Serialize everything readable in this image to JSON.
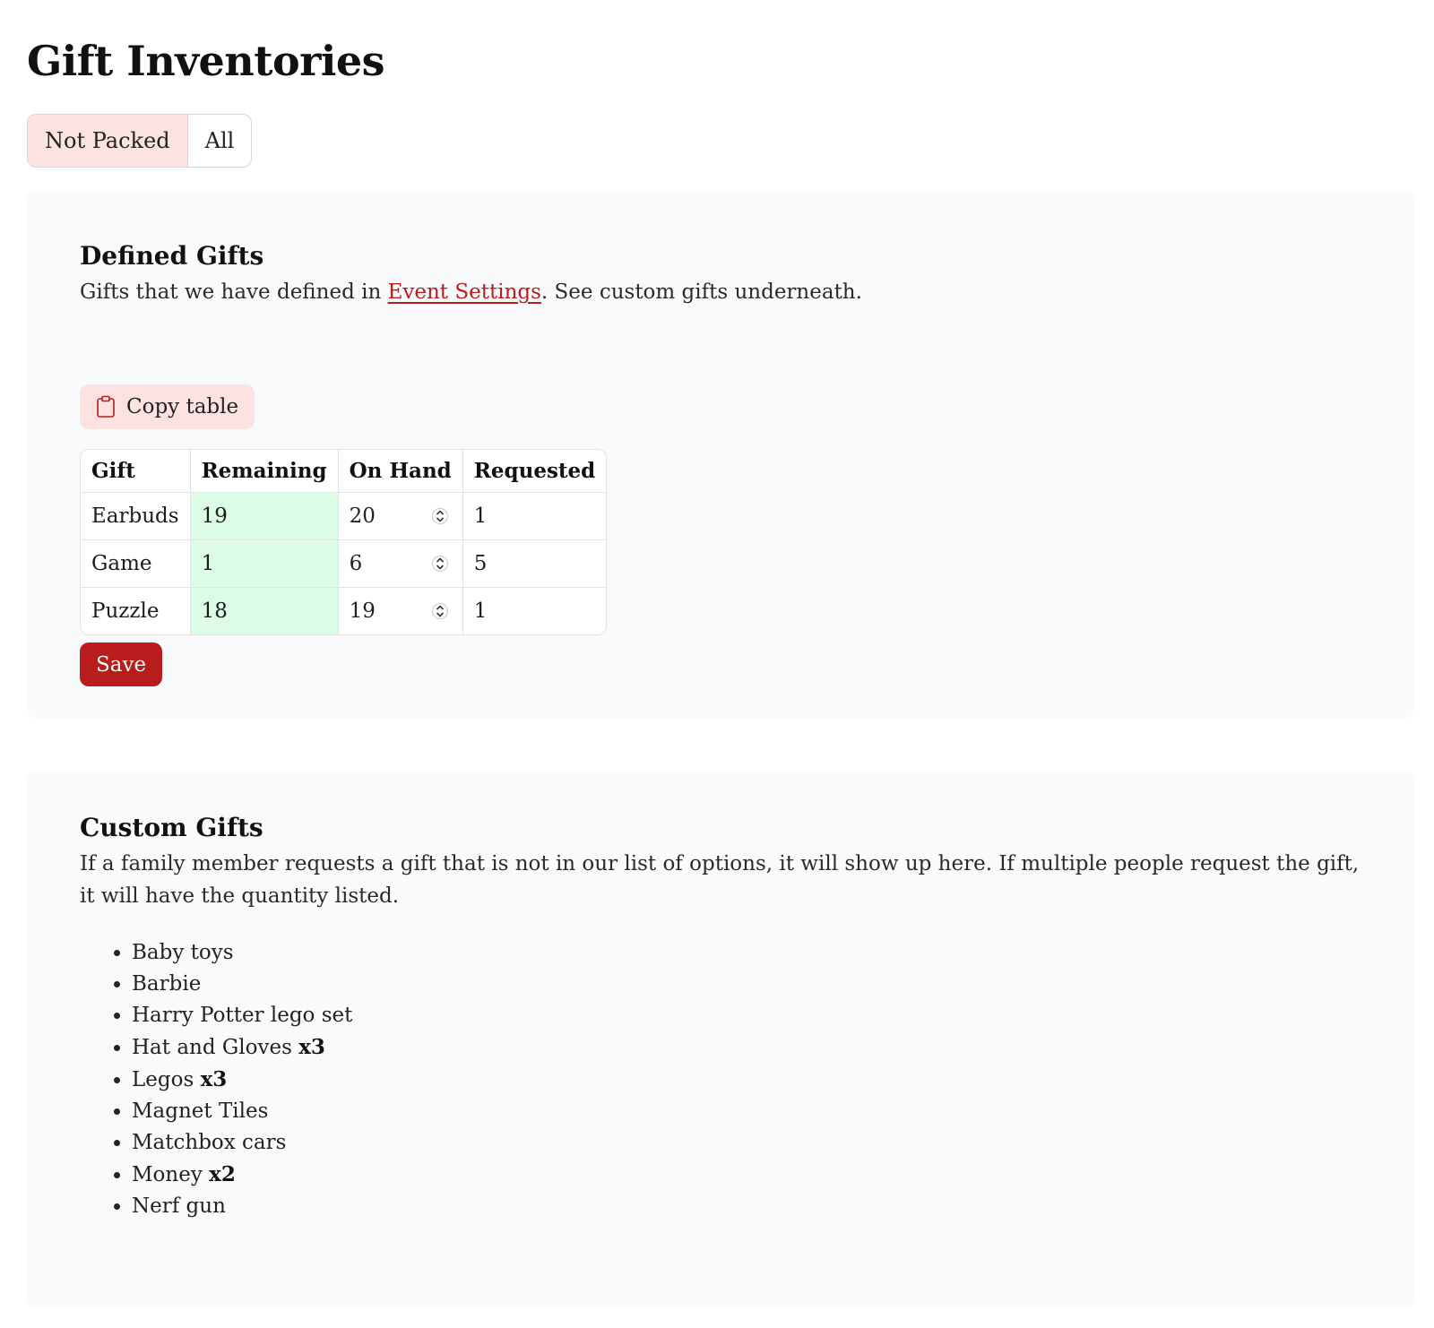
{
  "page": {
    "title": "Gift Inventories"
  },
  "filters": [
    {
      "label": "Not Packed",
      "active": true
    },
    {
      "label": "All",
      "active": false
    }
  ],
  "defined_gifts": {
    "title": "Defined Gifts",
    "desc_before": "Gifts that we have defined in ",
    "link_text": "Event Settings",
    "desc_after": ". See custom gifts underneath.",
    "copy_label": "Copy table",
    "copy_icon": "clipboard-icon",
    "columns": [
      "Gift",
      "Remaining",
      "On Hand",
      "Requested"
    ],
    "rows": [
      {
        "gift": "Earbuds",
        "remaining": "19",
        "on_hand": "20",
        "requested": "1"
      },
      {
        "gift": "Game",
        "remaining": "1",
        "on_hand": "6",
        "requested": "5"
      },
      {
        "gift": "Puzzle",
        "remaining": "18",
        "on_hand": "19",
        "requested": "1"
      }
    ],
    "save_label": "Save"
  },
  "custom_gifts": {
    "title": "Custom Gifts",
    "desc": "If a family member requests a gift that is not in our list of options, it will show up here. If multiple people request the gift, it will have the quantity listed.",
    "items": [
      {
        "name": "Baby toys",
        "qty": ""
      },
      {
        "name": "Barbie",
        "qty": ""
      },
      {
        "name": "Harry Potter lego set",
        "qty": ""
      },
      {
        "name": "Hat and Gloves ",
        "qty": "x3"
      },
      {
        "name": "Legos ",
        "qty": "x3"
      },
      {
        "name": "Magnet Tiles",
        "qty": ""
      },
      {
        "name": "Matchbox cars",
        "qty": ""
      },
      {
        "name": "Money ",
        "qty": "x2"
      },
      {
        "name": "Nerf gun",
        "qty": ""
      }
    ]
  },
  "colors": {
    "accent": "#b91c1c",
    "accent_soft": "#fde2e2",
    "remaining_bg": "#dcfce7",
    "card_bg": "#f8fafc"
  }
}
